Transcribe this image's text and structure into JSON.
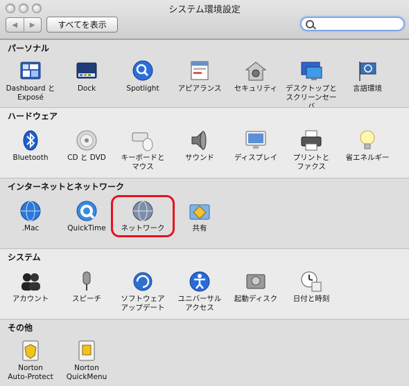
{
  "window": {
    "title": "システム環境設定"
  },
  "toolbar": {
    "back_glyph": "◀",
    "forward_glyph": "▶",
    "show_all_label": "すべてを表示",
    "search_value": "",
    "search_placeholder": ""
  },
  "sections": [
    {
      "title": "パーソナル",
      "panes": [
        {
          "label": "Dashboard と\nExposé",
          "icon": "dashboard-expose-icon"
        },
        {
          "label": "Dock",
          "icon": "dock-icon"
        },
        {
          "label": "Spotlight",
          "icon": "spotlight-icon"
        },
        {
          "label": "アピアランス",
          "icon": "appearance-icon"
        },
        {
          "label": "セキュリティ",
          "icon": "security-house-icon"
        },
        {
          "label": "デスクトップと\nスクリーンセーバ",
          "icon": "desktop-screensaver-icon"
        },
        {
          "label": "言語環境",
          "icon": "international-flag-icon"
        }
      ]
    },
    {
      "title": "ハードウェア",
      "panes": [
        {
          "label": "Bluetooth",
          "icon": "bluetooth-icon"
        },
        {
          "label": "CD と DVD",
          "icon": "cd-dvd-icon"
        },
        {
          "label": "キーボードと\nマウス",
          "icon": "keyboard-mouse-icon"
        },
        {
          "label": "サウンド",
          "icon": "speaker-icon"
        },
        {
          "label": "ディスプレイ",
          "icon": "display-icon"
        },
        {
          "label": "プリントと\nファクス",
          "icon": "printer-icon"
        },
        {
          "label": "省エネルギー",
          "icon": "lightbulb-icon"
        }
      ]
    },
    {
      "title": "インターネットとネットワーク",
      "panes": [
        {
          "label": ".Mac",
          "icon": "dotmac-globe-icon"
        },
        {
          "label": "QuickTime",
          "icon": "quicktime-icon"
        },
        {
          "label": "ネットワーク",
          "icon": "network-globe-icon"
        },
        {
          "label": "共有",
          "icon": "sharing-folder-icon"
        }
      ]
    },
    {
      "title": "システム",
      "panes": [
        {
          "label": "アカウント",
          "icon": "accounts-icon"
        },
        {
          "label": "スピーチ",
          "icon": "microphone-icon"
        },
        {
          "label": "ソフトウェア\nアップデート",
          "icon": "software-update-icon"
        },
        {
          "label": "ユニバーサル\nアクセス",
          "icon": "universal-access-icon"
        },
        {
          "label": "起動ディスク",
          "icon": "startup-disk-icon"
        },
        {
          "label": "日付と時刻",
          "icon": "date-time-icon"
        }
      ]
    },
    {
      "title": "その他",
      "panes": [
        {
          "label": "Norton\nAuto-Protect",
          "icon": "norton-autoprotect-icon"
        },
        {
          "label": "Norton\nQuickMenu",
          "icon": "norton-quickmenu-icon"
        }
      ]
    }
  ],
  "colors": {
    "highlight": "#e8101a",
    "accent": "#3a7fd8"
  }
}
